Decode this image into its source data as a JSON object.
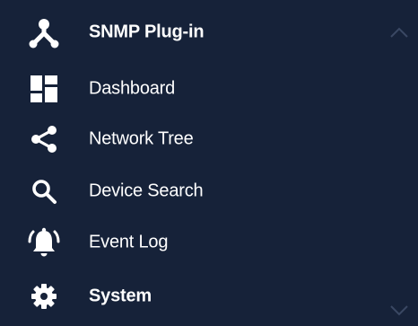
{
  "nav": {
    "header": {
      "label": "SNMP Plug-in",
      "icon": "hub-icon",
      "expanded": true
    },
    "items": [
      {
        "label": "Dashboard",
        "icon": "dashboard-icon"
      },
      {
        "label": "Network Tree",
        "icon": "share-icon"
      },
      {
        "label": "Device Search",
        "icon": "search-icon"
      },
      {
        "label": "Event Log",
        "icon": "alarm-bell-icon"
      }
    ],
    "footer": {
      "label": "System",
      "icon": "gear-icon",
      "expanded": false
    }
  },
  "colors": {
    "background": "#162239",
    "text": "#ffffff",
    "chevron": "#3a4863"
  }
}
